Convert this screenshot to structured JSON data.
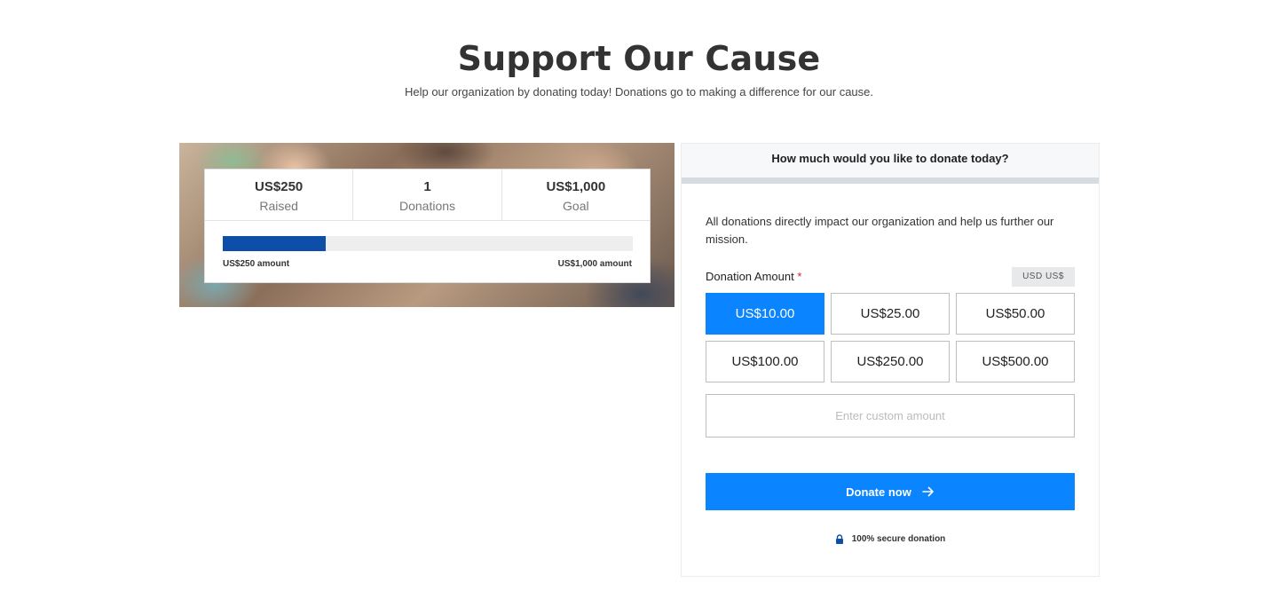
{
  "header": {
    "title": "Support Our Cause",
    "subtitle": "Help our organization by donating today! Donations go to making a difference for our cause."
  },
  "stats": [
    {
      "value": "US$250",
      "label": "Raised"
    },
    {
      "value": "1",
      "label": "Donations"
    },
    {
      "value": "US$1,000",
      "label": "Goal"
    }
  ],
  "progress": {
    "fraction": 0.25,
    "left_label": "US$250 amount",
    "right_label": "US$1,000 amount",
    "color": "#0d4fa8"
  },
  "form": {
    "heading": "How much would you like to donate today?",
    "description": "All donations directly impact our organization and help us further our mission.",
    "amount_label": "Donation Amount",
    "required_mark": "*",
    "currency_badge": "USD  US$",
    "amounts": [
      "US$10.00",
      "US$25.00",
      "US$50.00",
      "US$100.00",
      "US$250.00",
      "US$500.00"
    ],
    "selected_amount": "US$10.00",
    "custom_placeholder": "Enter custom amount",
    "donate_label": "Donate now",
    "secure_text": "100% secure donation",
    "accent_color": "#0a84ff"
  },
  "icons": {
    "donate_button": "arrow-right-icon",
    "secure": "lock-icon"
  }
}
